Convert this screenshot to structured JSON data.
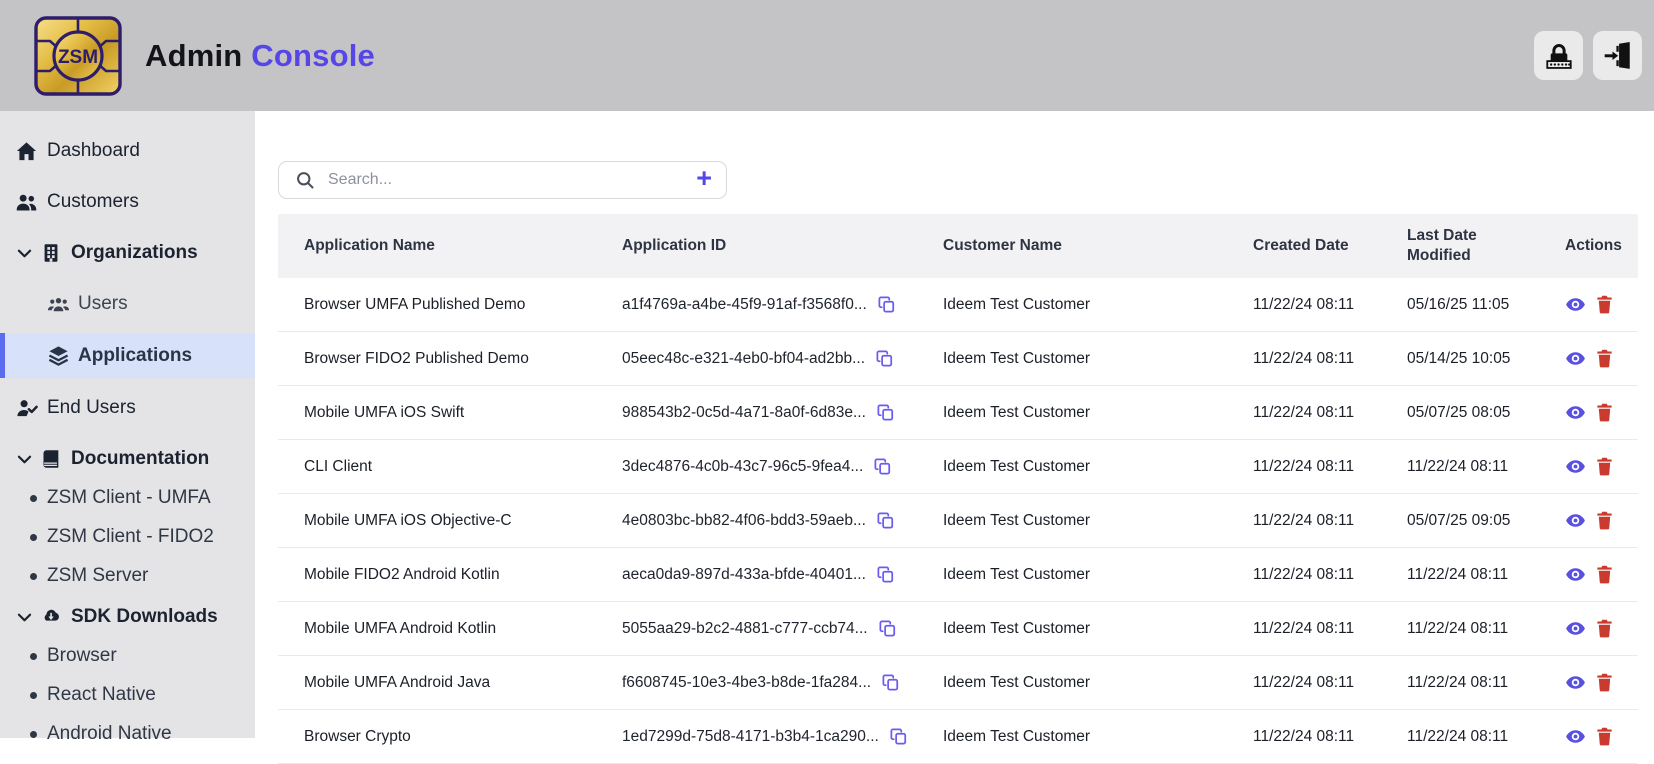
{
  "header": {
    "logo_text": "ZSM",
    "title_primary": "Admin",
    "title_accent": "Console",
    "accent_color": "#5646e8",
    "buttons": {
      "password_icon": "lock-password-icon",
      "logout_icon": "logout-icon"
    }
  },
  "sidebar": {
    "items": [
      {
        "label": "Dashboard",
        "icon": "home-icon"
      },
      {
        "label": "Customers",
        "icon": "users-icon"
      },
      {
        "label": "Organizations",
        "icon": "building-icon",
        "expanded": true
      },
      {
        "label": "Users",
        "icon": "user-group-icon"
      },
      {
        "label": "Applications",
        "icon": "layers-icon",
        "selected": true
      },
      {
        "label": "End Users",
        "icon": "user-check-icon"
      },
      {
        "label": "Documentation",
        "icon": "book-icon",
        "expanded": true
      },
      {
        "label": "ZSM Client - UMFA"
      },
      {
        "label": "ZSM Client - FIDO2"
      },
      {
        "label": "ZSM Server"
      },
      {
        "label": "SDK Downloads",
        "icon": "cloud-download-icon",
        "expanded": true
      },
      {
        "label": "Browser"
      },
      {
        "label": "React Native"
      },
      {
        "label": "Android Native"
      }
    ],
    "selected_bg": "#d7e2fa",
    "selected_border": "#5b6cf0"
  },
  "search": {
    "placeholder": "Search...",
    "add_label": "+"
  },
  "table": {
    "columns": [
      "Application Name",
      "Application ID",
      "Customer Name",
      "Created Date",
      "Last Date Modified",
      "Actions"
    ],
    "rows": [
      {
        "name": "Browser UMFA Published Demo",
        "id": "a1f4769a-a4be-45f9-91af-f3568f0...",
        "customer": "Ideem Test Customer",
        "created": "11/22/24 08:11",
        "modified": "05/16/25 11:05"
      },
      {
        "name": "Browser FIDO2 Published Demo",
        "id": "05eec48c-e321-4eb0-bf04-ad2bb...",
        "customer": "Ideem Test Customer",
        "created": "11/22/24 08:11",
        "modified": "05/14/25 10:05"
      },
      {
        "name": "Mobile UMFA iOS Swift",
        "id": "988543b2-0c5d-4a71-8a0f-6d83e...",
        "customer": "Ideem Test Customer",
        "created": "11/22/24 08:11",
        "modified": "05/07/25 08:05"
      },
      {
        "name": "CLI Client",
        "id": "3dec4876-4c0b-43c7-96c5-9fea4...",
        "customer": "Ideem Test Customer",
        "created": "11/22/24 08:11",
        "modified": "11/22/24 08:11"
      },
      {
        "name": "Mobile UMFA iOS Objective-C",
        "id": "4e0803bc-bb82-4f06-bdd3-59aeb...",
        "customer": "Ideem Test Customer",
        "created": "11/22/24 08:11",
        "modified": "05/07/25 09:05"
      },
      {
        "name": "Mobile FIDO2 Android Kotlin",
        "id": "aeca0da9-897d-433a-bfde-40401...",
        "customer": "Ideem Test Customer",
        "created": "11/22/24 08:11",
        "modified": "11/22/24 08:11"
      },
      {
        "name": "Mobile UMFA Android Kotlin",
        "id": "5055aa29-b2c2-4881-c777-ccb74...",
        "customer": "Ideem Test Customer",
        "created": "11/22/24 08:11",
        "modified": "11/22/24 08:11"
      },
      {
        "name": "Mobile UMFA Android Java",
        "id": "f6608745-10e3-4be3-b8de-1fa284...",
        "customer": "Ideem Test Customer",
        "created": "11/22/24 08:11",
        "modified": "11/22/24 08:11"
      },
      {
        "name": "Browser Crypto",
        "id": "1ed7299d-75d8-4171-b3b4-1ca290...",
        "customer": "Ideem Test Customer",
        "created": "11/22/24 08:11",
        "modified": "11/22/24 08:11"
      }
    ],
    "icons": {
      "copy": "copy-icon",
      "view": "eye-icon",
      "delete": "trash-icon"
    },
    "action_colors": {
      "view": "#5a50e0",
      "delete": "#c93b2e"
    }
  }
}
